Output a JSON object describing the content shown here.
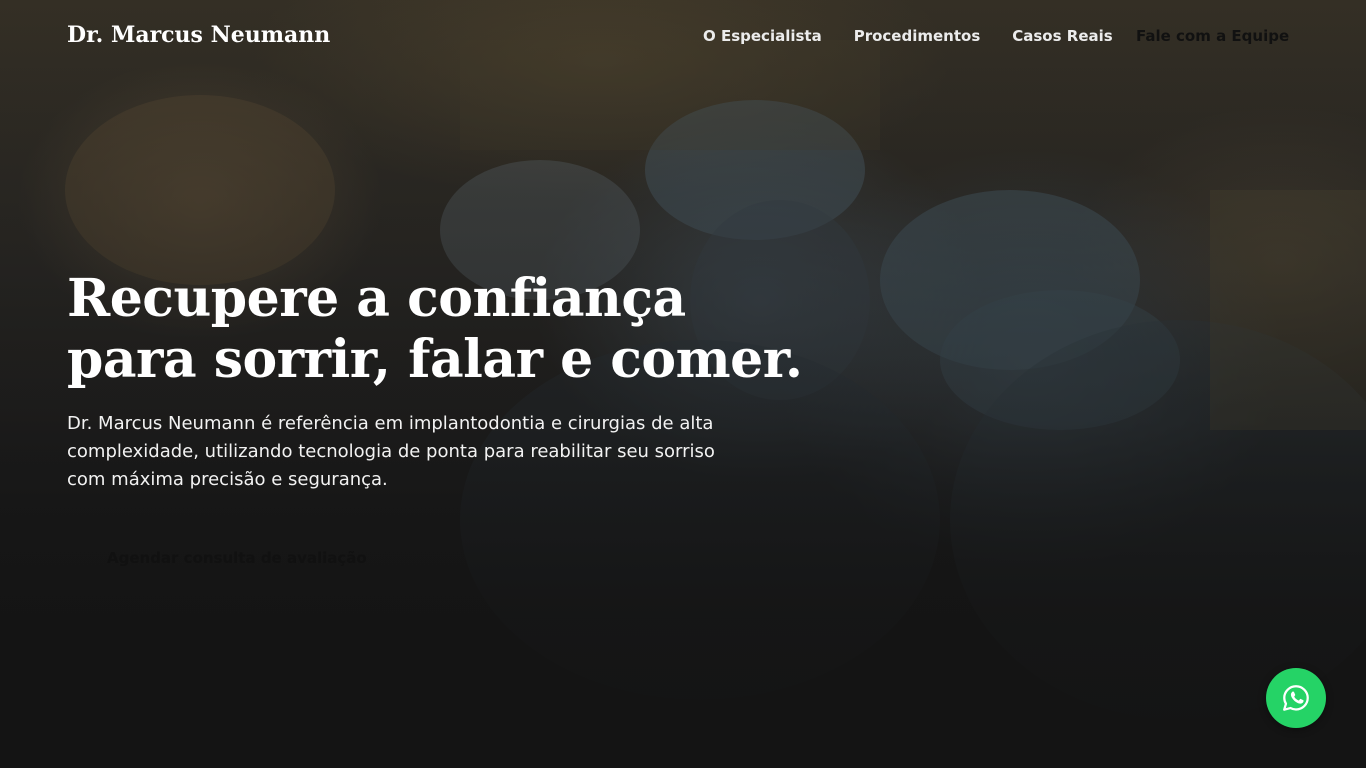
{
  "brand": {
    "name": "Dr. Marcus Neumann"
  },
  "nav": {
    "links": [
      "O Especialista",
      "Procedimentos",
      "Casos Reais"
    ],
    "cta": "Fale com a Equipe"
  },
  "hero": {
    "headline_line1": "Recupere a confiança",
    "headline_line2": "para sorrir, falar e comer.",
    "subtext": "Dr. Marcus Neumann é referência em implantodontia e cirurgias de alta complexidade, utilizando tecnologia de ponta para reabilitar seu sorriso com máxima precisão e segurança.",
    "cta_label": "Agendar consulta de avaliação"
  },
  "floating": {
    "whatsapp_icon": "whatsapp-icon",
    "whatsapp_color": "#25d366"
  },
  "colors": {
    "overlay_dark": "#141414",
    "text_light": "#ffffff",
    "text_dark": "#111111"
  }
}
